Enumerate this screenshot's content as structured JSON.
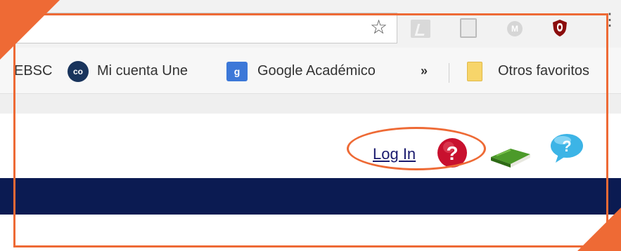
{
  "browser": {
    "bookmarks": [
      {
        "label": "EBSC",
        "icon": "none"
      },
      {
        "label": "Mi cuenta Une",
        "icon": "co-icon",
        "icon_text": "co"
      },
      {
        "label": "Google Académico",
        "icon": "google-scholar-icon",
        "icon_text": "g"
      },
      {
        "label": "»",
        "icon": "overflow"
      },
      {
        "label": "Otros favoritos",
        "icon": "folder-icon"
      }
    ],
    "toolbar_icons": [
      "star-icon",
      "pdf-extension-icon",
      "document-extension-icon",
      "m-extension-icon",
      "shield-extension-icon",
      "menu-dots-icon"
    ],
    "m_icon_text": "M"
  },
  "page": {
    "login_label": "Log In",
    "help_icon": "question-red-icon",
    "book_icon": "book-icon",
    "help_chat_icon": "question-bubble-icon"
  },
  "colors": {
    "annotation": "#ee6a35",
    "nav_band": "#0b1b52",
    "link": "#1a1a6e"
  }
}
